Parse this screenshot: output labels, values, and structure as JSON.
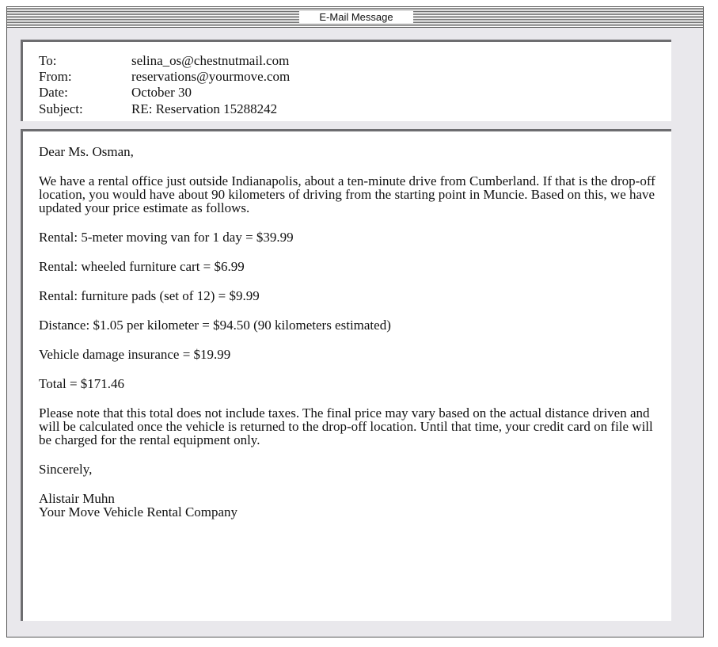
{
  "window": {
    "title": "E-Mail Message"
  },
  "header": {
    "to_label": "To:",
    "to_value": "selina_os@chestnutmail.com",
    "from_label": "From:",
    "from_value": "reservations@yourmove.com",
    "date_label": "Date:",
    "date_value": "October 30",
    "subject_label": "Subject:",
    "subject_value": "RE: Reservation 15288242"
  },
  "body": {
    "greeting": "Dear Ms. Osman,",
    "intro": "We have a rental office just outside Indianapolis, about a ten-minute drive from Cumberland. If that is the drop-off location, you would have about 90 kilometers of driving from the starting point in Muncie. Based on this, we have updated your price estimate as follows.",
    "line_items": [
      "Rental: 5-meter moving van for 1 day = $39.99",
      "Rental: wheeled furniture cart = $6.99",
      "Rental: furniture pads (set of 12) = $9.99",
      "Distance: $1.05 per kilometer = $94.50 (90 kilometers estimated)",
      "Vehicle damage insurance = $19.99"
    ],
    "total": "Total = $171.46",
    "note": "Please note that this total does not include taxes. The final price may vary based on the actual distance driven and will be calculated once the vehicle is returned to the drop-off location. Until that time, your credit card on file will be charged for the rental equipment only.",
    "signoff": "Sincerely,",
    "sender_name": "Alistair Muhn",
    "sender_company": "Your Move Vehicle Rental Company"
  }
}
